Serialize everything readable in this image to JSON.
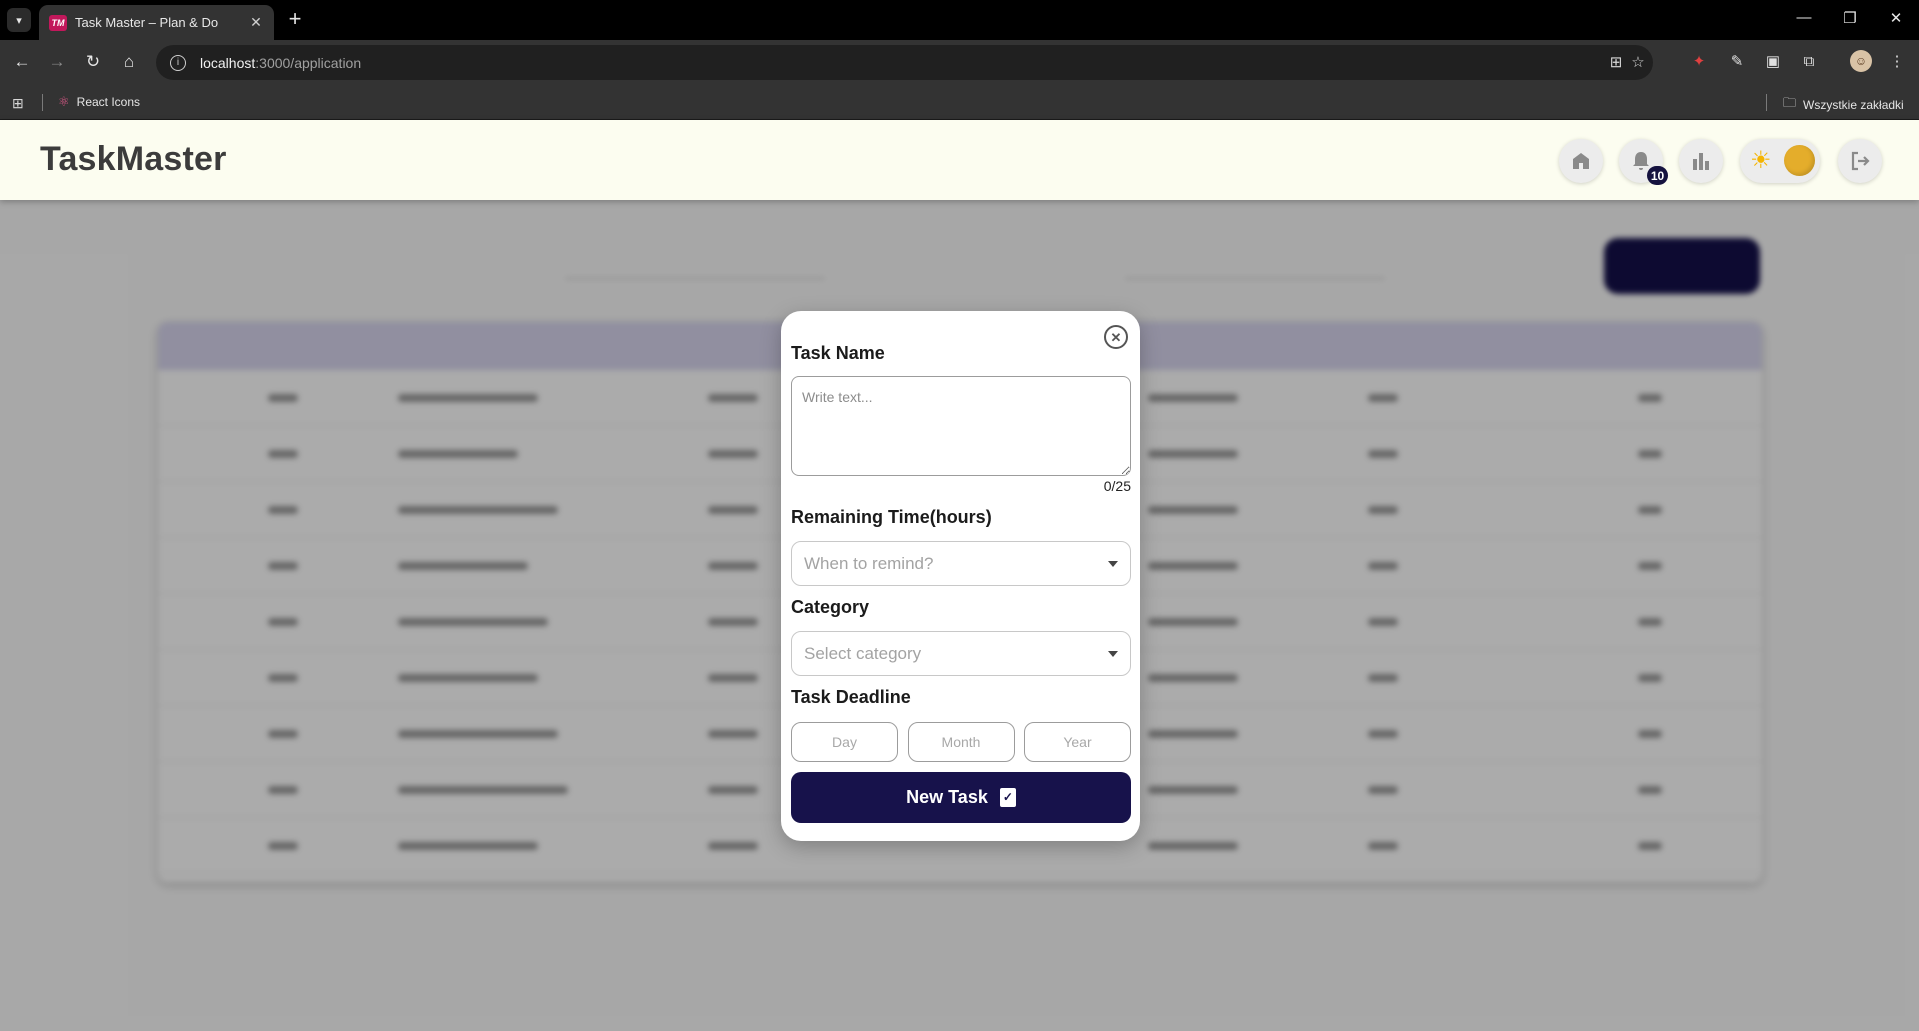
{
  "browser": {
    "tab_title": "Task Master – Plan & Do",
    "tab_favicon_text": "TM",
    "url_host": "localhost",
    "url_path": ":3000/application",
    "bookmarks": [
      {
        "label": "React Icons",
        "icon": "react-atom-icon"
      }
    ],
    "bookmarks_folder": "Wszystkie zakładki"
  },
  "header": {
    "brand": "TaskMaster",
    "notification_count": "10",
    "icons": [
      "home-icon",
      "bell-icon",
      "bar-chart-icon",
      "theme-toggle",
      "logout-icon"
    ]
  },
  "modal": {
    "task_name_label": "Task Name",
    "task_name_placeholder": "Write text...",
    "task_name_counter": "0/25",
    "remaining_time_label": "Remaining Time(hours)",
    "remaining_time_placeholder": "When to remind?",
    "category_label": "Category",
    "category_placeholder": "Select category",
    "deadline_label": "Task Deadline",
    "day_placeholder": "Day",
    "month_placeholder": "Month",
    "year_placeholder": "Year",
    "submit_label": "New Task"
  },
  "colors": {
    "brand_navy": "#17124b",
    "header_bg": "#fcfdf0",
    "badge_bg": "#15123f",
    "theme_knob": "#e4ad2b"
  }
}
